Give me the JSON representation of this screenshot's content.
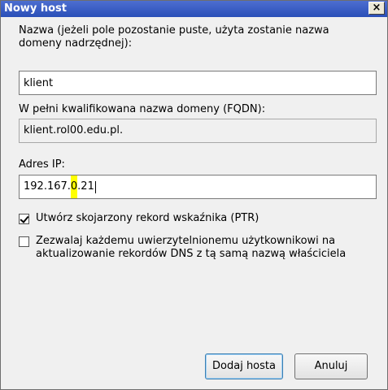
{
  "window": {
    "title": "Nowy host",
    "close_label": "×"
  },
  "name": {
    "label": "Nazwa (jeżeli pole pozostanie puste, użyta zostanie nazwa domeny nadrzędnej):",
    "value": "klient"
  },
  "fqdn": {
    "label": "W pełni kwalifikowana nazwa domeny (FQDN):",
    "value": "klient.rol00.edu.pl."
  },
  "ip": {
    "label": "Adres IP:",
    "value_before": "192.167.",
    "value_highlight": "0",
    "value_after": ".21"
  },
  "options": {
    "ptr_label": "Utwórz skojarzony rekord wskaźnika (PTR)",
    "ptr_checked": true,
    "allow_label": "Zezwalaj każdemu uwierzytelnionemu użytkownikowi na aktualizowanie rekordów DNS z tą samą nazwą właściciela",
    "allow_checked": false
  },
  "buttons": {
    "add": "Dodaj hosta",
    "cancel": "Anuluj"
  },
  "colors": {
    "titlebar": "#2a4fb8",
    "highlight": "#ffff00",
    "dialog_bg": "#f0f0f0"
  }
}
